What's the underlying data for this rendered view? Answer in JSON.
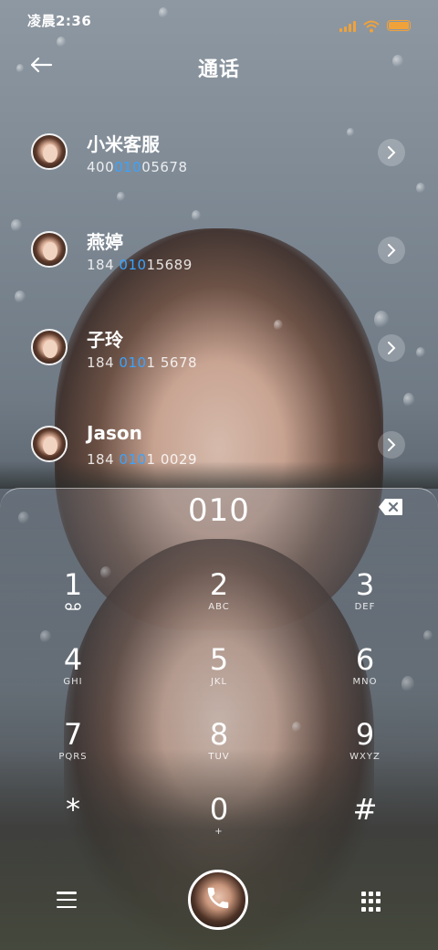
{
  "status_bar": {
    "time": "凌晨2:36",
    "signal_icon": "signal-icon",
    "wifi_icon": "wifi-icon",
    "battery_icon": "battery-icon",
    "accent_color": "#f0a23a"
  },
  "header": {
    "back_icon": "back-arrow-icon",
    "title": "通话"
  },
  "contacts": [
    {
      "name": "小米客服",
      "number_prefix": "400",
      "number_match": "010",
      "number_suffix": "05678"
    },
    {
      "name": "燕婷",
      "number_prefix": "184 ",
      "number_match": "010",
      "number_suffix": "15689"
    },
    {
      "name": "子玲",
      "number_prefix": "184 ",
      "number_match": "010",
      "number_suffix": "1 5678"
    },
    {
      "name": "Jason",
      "number_prefix": "184 ",
      "number_match": "010",
      "number_suffix": "1 0029"
    }
  ],
  "highlight_color": "#3aa3ff",
  "dialer": {
    "input": "010",
    "backspace_icon": "backspace-icon",
    "keys": [
      {
        "digit": "1",
        "letters": "",
        "icon": "voicemail-icon"
      },
      {
        "digit": "2",
        "letters": "ABC"
      },
      {
        "digit": "3",
        "letters": "DEF"
      },
      {
        "digit": "4",
        "letters": "GHI"
      },
      {
        "digit": "5",
        "letters": "JKL"
      },
      {
        "digit": "6",
        "letters": "MNO"
      },
      {
        "digit": "7",
        "letters": "PQRS"
      },
      {
        "digit": "8",
        "letters": "TUV"
      },
      {
        "digit": "9",
        "letters": "WXYZ"
      },
      {
        "digit": "*",
        "letters": ""
      },
      {
        "digit": "0",
        "letters": "+"
      },
      {
        "digit": "#",
        "letters": ""
      }
    ],
    "menu_icon": "menu-icon",
    "call_icon": "phone-icon",
    "keypad_toggle_icon": "keypad-icon"
  }
}
